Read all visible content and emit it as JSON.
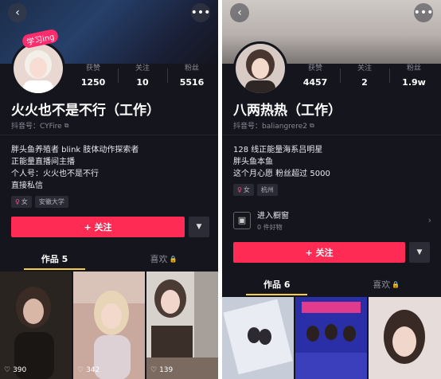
{
  "left": {
    "badge": "学习ing",
    "stats": [
      {
        "label": "获赞",
        "value": "1250"
      },
      {
        "label": "关注",
        "value": "10"
      },
      {
        "label": "粉丝",
        "value": "5516"
      }
    ],
    "name": "火火也不是不行（工作）",
    "dy_id": "抖音号：CYFire",
    "bio": [
      "胖头鱼养殖者 blink 肢体动作探索者",
      "正能量直播间主播",
      "个人号：火火也不是不行",
      "直接私信"
    ],
    "tags": [
      "女",
      "安徽大学"
    ],
    "follow_label": "+ 关注",
    "tabs": {
      "works": "作品 5",
      "likes": "喜欢"
    },
    "thumbs": [
      {
        "likes": "390"
      },
      {
        "likes": "342"
      },
      {
        "likes": "139"
      }
    ]
  },
  "right": {
    "stats": [
      {
        "label": "获赞",
        "value": "4457"
      },
      {
        "label": "关注",
        "value": "2"
      },
      {
        "label": "粉丝",
        "value": "1.9w"
      }
    ],
    "name": "八两热热（工作）",
    "dy_id": "抖音号：baliangrere2",
    "bio": [
      "128 线正能量海系吕明星",
      "胖头鱼本鱼",
      "这个月心愿 粉丝超过 5000"
    ],
    "tags": [
      "女",
      "杭州"
    ],
    "shop": {
      "title": "进入橱窗",
      "subtitle": "0 件好物"
    },
    "follow_label": "+ 关注",
    "tabs": {
      "works": "作品 6",
      "likes": "喜欢"
    }
  },
  "colors": {
    "accent": "#fe2c55",
    "tab_indicator": "#f6cd41",
    "background": "#15151e"
  },
  "icons": [
    "back-icon",
    "more-icon",
    "copy-icon",
    "female-icon",
    "shop-icon",
    "lock-icon",
    "heart-icon",
    "dropdown-icon"
  ]
}
